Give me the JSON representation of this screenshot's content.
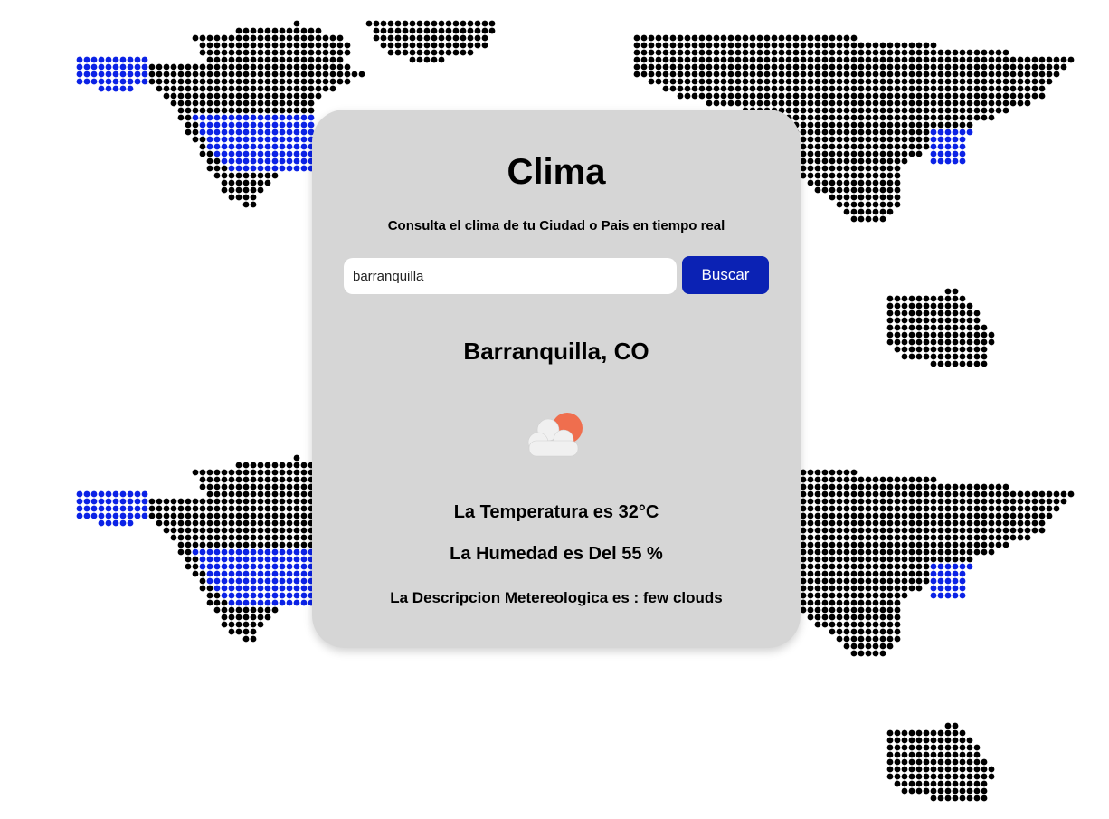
{
  "app": {
    "title": "Clima",
    "subtitle": "Consulta el clima de tu Ciudad o Pais en tiempo real"
  },
  "search": {
    "value": "barranquilla",
    "button_label": "Buscar"
  },
  "result": {
    "city": "Barranquilla, CO",
    "icon": "few-clouds-icon",
    "temperature_text": "La Temperatura es 32°C",
    "humidity_text": "La Humedad es Del 55 %",
    "description_text": "La Descripcion Metereologica es : few clouds"
  },
  "colors": {
    "card_background": "#d6d6d6",
    "button": "#0b22b4",
    "map_dots": "#000000",
    "map_highlight": "#0b22e6",
    "sun": "#ef6e4e",
    "cloud": "#f0f0f0"
  }
}
